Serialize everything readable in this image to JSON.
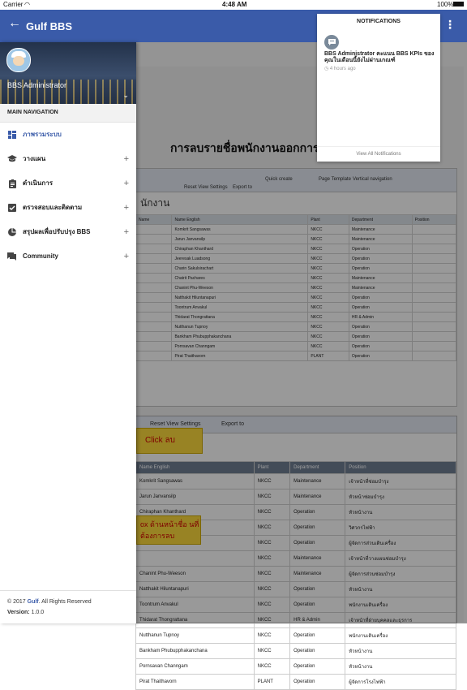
{
  "status_bar": {
    "carrier": "Carrier",
    "time": "4:48 AM",
    "battery": "100%"
  },
  "app_bar": {
    "title": "Gulf BBS",
    "back_icon": "arrow-left-icon",
    "menu_icon": "more-vertical-icon"
  },
  "drawer": {
    "user_name": "BBS Administrator",
    "section_header": "MAIN NAVIGATION",
    "items": [
      {
        "label": "ภาพรวมระบบ",
        "icon": "dashboard-icon",
        "active": true,
        "expandable": false
      },
      {
        "label": "วางแผน",
        "icon": "school-icon",
        "active": false,
        "expandable": true
      },
      {
        "label": "ดำเนินการ",
        "icon": "assignment-icon",
        "active": false,
        "expandable": true
      },
      {
        "label": "ตรวจสอบและติดตาม",
        "icon": "check-box-icon",
        "active": false,
        "expandable": true
      },
      {
        "label": "สรุปผลเพื่อปรับปรุง BBS",
        "icon": "pie-chart-icon",
        "active": false,
        "expandable": true
      },
      {
        "label": "Community",
        "icon": "forum-icon",
        "active": false,
        "expandable": true
      }
    ],
    "footer": {
      "copyright_prefix": "© 2017",
      "brand": "Gulf",
      "copyright_suffix": ". All Rights Reserved",
      "version_label": "Version:",
      "version": "1.0.0"
    }
  },
  "notifications": {
    "header": "NOTIFICATIONS",
    "items": [
      {
        "text": "BBS Administrator คะแนน BBS KPIs ของคุณในเดือนนี้ยังไม่ผ่านเกณฑ์",
        "time": "4 hours ago"
      }
    ],
    "view_all": "View All Notifications"
  },
  "background_doc": {
    "title": "การลบรายชื่อพนักงานออกการ",
    "panel1": {
      "toolbar": [
        "Quick create",
        "Page Template",
        "Vertical navigation",
        "Reset View Settings",
        "Export to"
      ],
      "subtitle": "นักงาน",
      "headers": [
        "Name",
        "Name English",
        "Plant",
        "Department",
        "Position"
      ],
      "rows": [
        [
          "",
          "Komkrit Sangsawas",
          "NKCC",
          "Maintenance",
          ""
        ],
        [
          "",
          "Jarun Janvansilp",
          "NKCC",
          "Maintenance",
          ""
        ],
        [
          "",
          "Chiraphan Khanthard",
          "NKCC",
          "Operation",
          ""
        ],
        [
          "",
          "Jeeresak Luadsong",
          "NKCC",
          "Operation",
          ""
        ],
        [
          "",
          "Charin Sakulsirachart",
          "NKCC",
          "Operation",
          ""
        ],
        [
          "",
          "Chatrit Pachares",
          "NKCC",
          "Maintenance",
          ""
        ],
        [
          "",
          "Chanint Phu-Weeson",
          "NKCC",
          "Maintenance",
          ""
        ],
        [
          "",
          "Natthakit Hiluntanapuri",
          "NKCC",
          "Operation",
          ""
        ],
        [
          "",
          "Toontrum Anvakul",
          "NKCC",
          "Operation",
          ""
        ],
        [
          "",
          "Thidarat Thongrattana",
          "NKCC",
          "HR & Admin",
          ""
        ],
        [
          "",
          "Nutthanun Tupnoy",
          "NKCC",
          "Operation",
          ""
        ],
        [
          "",
          "Bankham Phubupphakanchana",
          "NKCC",
          "Operation",
          ""
        ],
        [
          "",
          "Pornsavan Channgam",
          "NKCC",
          "Operation",
          ""
        ],
        [
          "",
          "Pirat Thaithavorn",
          "PLANT",
          "Operation",
          ""
        ]
      ]
    },
    "panel2": {
      "toolbar": [
        "Reset View Settings",
        "Export to"
      ],
      "headers": [
        "Name English",
        "Plant",
        "Department",
        "Position"
      ],
      "rows": [
        [
          "Komkrit Sangsawas",
          "NKCC",
          "Maintenance",
          "เจ้าหน้าที่ซ่อมบำรุง"
        ],
        [
          "Jarun Janvansilp",
          "NKCC",
          "Maintenance",
          "หัวหน้าซ่อมบำรุง"
        ],
        [
          "Chiraphan Khanthard",
          "NKCC",
          "Operation",
          "หัวหน้างาน"
        ],
        [
          "Jeeresak Luadsong",
          "NKCC",
          "Operation",
          "วิศวกรไฟฟ้า"
        ],
        [
          "Charin Sakulsirachart",
          "NKCC",
          "Operation",
          "ผู้จัดการส่วนเดินเครื่อง"
        ],
        [
          "",
          "NKCC",
          "Maintenance",
          "เจ้าหน้าที่วางแผนซ่อมบำรุง"
        ],
        [
          "Chanint Phu-Weeson",
          "NKCC",
          "Maintenance",
          "ผู้จัดการส่วนซ่อมบำรุง"
        ],
        [
          "Natthakit Hiluntanapuri",
          "NKCC",
          "Operation",
          "หัวหน้างาน"
        ],
        [
          "Toontrum Anvakul",
          "NKCC",
          "Operation",
          "พนักงานเดินเครื่อง"
        ],
        [
          "Thidarat Thongrattana",
          "NKCC",
          "HR & Admin",
          "เจ้าหน้าที่ฝ่ายบุคคลและธุรการ"
        ],
        [
          "Nutthanun Tupnoy",
          "NKCC",
          "Operation",
          "พนักงานเดินเครื่อง"
        ],
        [
          "Bankham Phubupphakanchana",
          "NKCC",
          "Operation",
          "หัวหน้างาน"
        ],
        [
          "Pornsavan Channgam",
          "NKCC",
          "Operation",
          "หัวหน้างาน"
        ],
        [
          "Pirat Thaithavorn",
          "PLANT",
          "Operation",
          "ผู้จัดการโรงไฟฟ้า"
        ]
      ]
    },
    "callout_click": "Click ลบ",
    "callout_checkbox": "ox ด้านหน้าชื่อ นที่ต้องการลบ"
  },
  "colors": {
    "app_bar": "#3a5ba9",
    "drawer_bg": "#ffffff",
    "active_item": "#3a5ba9",
    "callout": "#f6d33b"
  }
}
